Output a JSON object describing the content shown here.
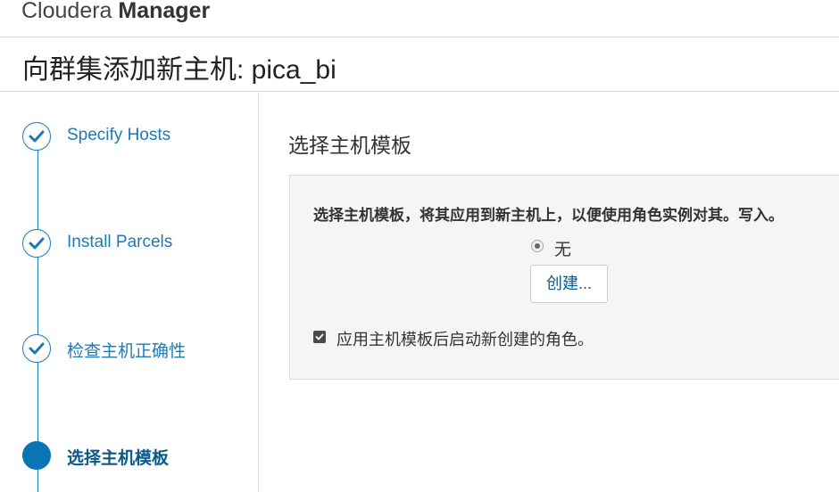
{
  "app": {
    "brand_light": "Cloudera ",
    "brand_bold": "Manager"
  },
  "header": {
    "title": "向群集添加新主机: pica_bi"
  },
  "sidebar": {
    "steps": [
      {
        "label": "Specify Hosts",
        "state": "completed",
        "icon": "check-icon"
      },
      {
        "label": "Install Parcels",
        "state": "completed",
        "icon": "check-icon"
      },
      {
        "label": "检查主机正确性",
        "state": "completed",
        "icon": "check-icon"
      },
      {
        "label": "选择主机模板",
        "state": "active",
        "icon": "current-step-dot"
      }
    ]
  },
  "main": {
    "section_title": "选择主机模板",
    "panel": {
      "description": "选择主机模板，将其应用到新主机上，以便使用角色实例对其。写入。",
      "radio_option": {
        "label": "无",
        "selected": true
      },
      "create_button_label": "创建...",
      "checkbox": {
        "label": "应用主机模板后启动新创建的角色。",
        "checked": true
      }
    }
  },
  "colors": {
    "accent": "#1e7ab3",
    "active_step": "#0a74b5",
    "border": "#dddddd",
    "panel_bg": "#f5f5f5"
  }
}
